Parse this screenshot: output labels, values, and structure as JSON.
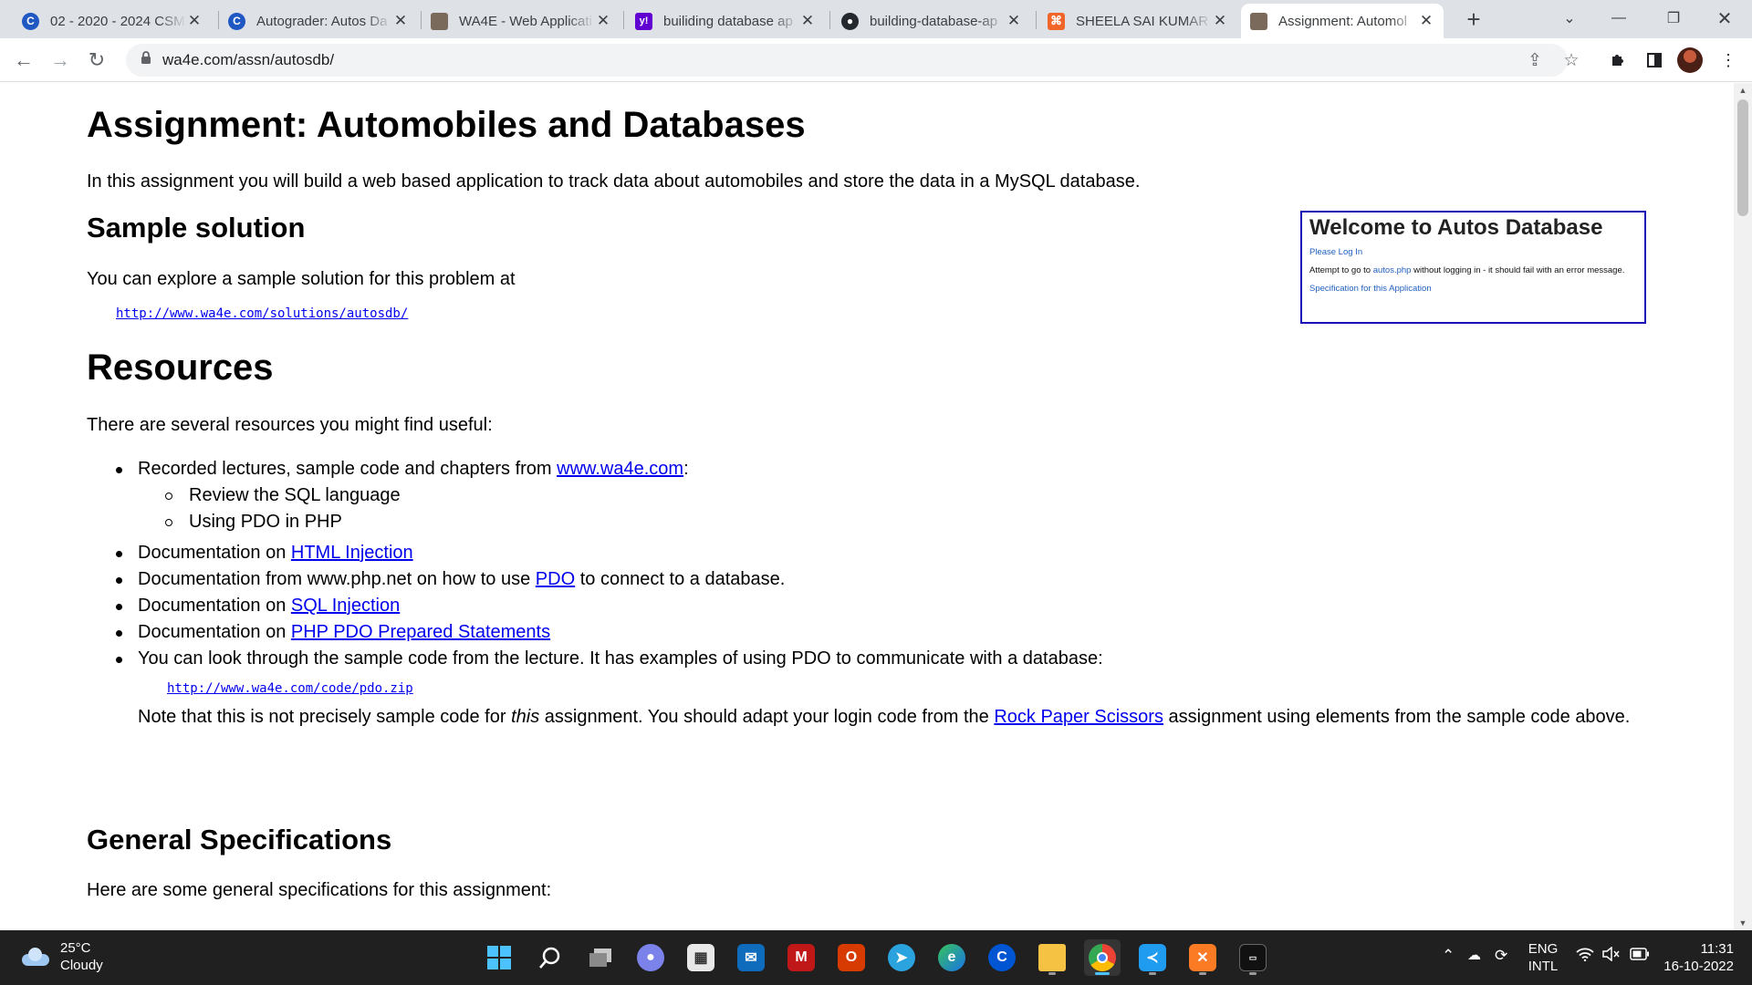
{
  "browser": {
    "tabs": [
      {
        "title": "02 - 2020 - 2024 CSM",
        "icon": "coursera-icon"
      },
      {
        "title": "Autograder: Autos Da",
        "icon": "coursera-icon"
      },
      {
        "title": "WA4E - Web Applicati",
        "icon": "wa4e-icon"
      },
      {
        "title": "builiding database ap",
        "icon": "yahoo-icon"
      },
      {
        "title": "building-database-ap",
        "icon": "github-icon"
      },
      {
        "title": "SHEELA SAI KUMAR",
        "icon": "codepen-icon"
      },
      {
        "title": "Assignment: Automol",
        "icon": "wa4e-icon",
        "active": true
      }
    ],
    "url": "wa4e.com/assn/autosdb/"
  },
  "page": {
    "title": "Assignment: Automobiles and Databases",
    "intro": "In this assignment you will build a web based application to track data about automobiles and store the data in a MySQL database.",
    "sample_heading": "Sample solution",
    "sample_text": "You can explore a sample solution for this problem at",
    "sample_url": "http://www.wa4e.com/solutions/autosdb/",
    "preview": {
      "heading": "Welcome to Autos Database",
      "login_link": "Please Log In",
      "attempt_prefix": "Attempt to go to",
      "attempt_link": "autos.php",
      "attempt_suffix": "without logging in - it should fail with an error message.",
      "spec_link": "Specification for this Application"
    },
    "resources_heading": "Resources",
    "resources_intro": "There are several resources you might find useful:",
    "resources": {
      "r1_prefix": "Recorded lectures, sample code and chapters from",
      "r1_link": "www.wa4e.com",
      "r1_suffix": ":",
      "sub1": "Review the SQL language",
      "sub2": "Using PDO in PHP",
      "r2_prefix": "Documentation on",
      "r2_link": "HTML Injection",
      "r3_prefix": "Documentation from www.php.net on how to use",
      "r3_link": "PDO",
      "r3_suffix": "to connect to a database.",
      "r4_prefix": "Documentation on",
      "r4_link": "SQL Injection",
      "r5_prefix": "Documentation on",
      "r5_link": "PHP PDO Prepared Statements",
      "r6": "You can look through the sample code from the lecture. It has examples of using PDO to communicate with a database:",
      "pdo_url": "http://www.wa4e.com/code/pdo.zip",
      "note_prefix": "Note that this is not precisely sample code for",
      "note_em": "this",
      "note_mid": "assignment. You should adapt your login code from the",
      "note_link": "Rock Paper Scissors",
      "note_suffix": "assignment using elements from the sample code above."
    },
    "general_heading": "General Specifications",
    "general_intro": "Here are some general specifications for this assignment:"
  },
  "taskbar": {
    "weather_temp": "25°C",
    "weather_desc": "Cloudy",
    "lang_top": "ENG",
    "lang_bottom": "INTL",
    "time": "11:31",
    "date": "16-10-2022"
  }
}
